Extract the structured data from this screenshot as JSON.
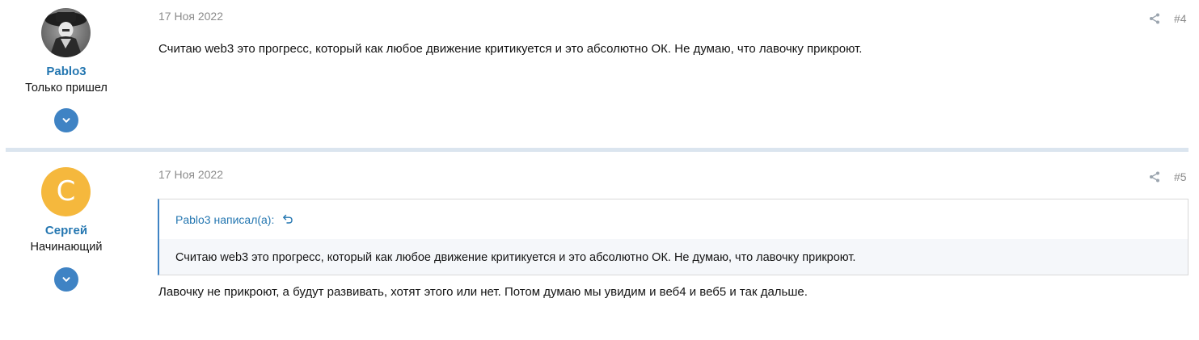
{
  "posts": [
    {
      "author": "Pablo3",
      "user_title": "Только пришел",
      "avatar": "photo-avatar",
      "date": "17 Ноя 2022",
      "number": "#4",
      "body": "Считаю web3 это прогресс, который как любое движение критикуется и это абсолютно ОК. Не думаю, что лавочку прикроют."
    },
    {
      "author": "Сергей",
      "user_title": "Начинающий",
      "avatar_letter": "С",
      "avatar_color": "#f5b83d",
      "date": "17 Ноя 2022",
      "number": "#5",
      "quote": {
        "author": "Pablo3 написал(а):",
        "text": "Считаю web3 это прогресс, который как любое движение критикуется и это абсолютно ОК. Не думаю, что лавочку прикроют."
      },
      "body": "Лавочку не прикроют, а будут развивать, хотят этого или нет. Потом думаю мы увидим и веб4 и веб5 и так дальше."
    }
  ],
  "icons": {
    "share": "share-icon",
    "expand": "chevron-down-icon",
    "jump": "undo-arrow-icon"
  },
  "colors": {
    "link": "#2577b1",
    "accent": "#3f83c4",
    "muted": "#8c8c8c",
    "separator": "#dbe5ef"
  }
}
